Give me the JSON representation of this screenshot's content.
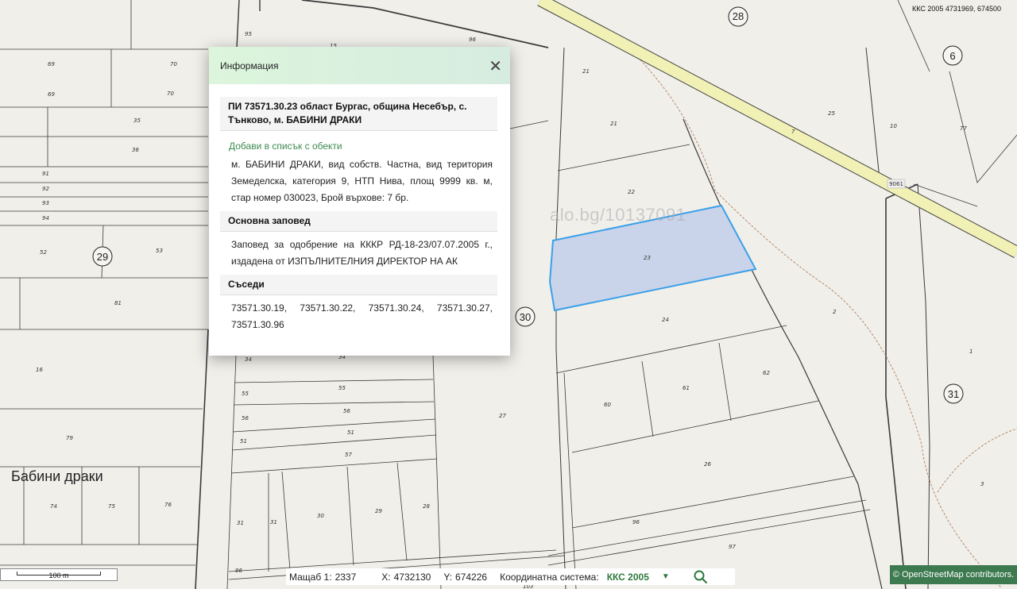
{
  "map": {
    "coord_readout": "ККС 2005 4731969, 674500",
    "watermark": "alo.bg/10137091",
    "area_name": "Бабини драки",
    "circle_labels": [
      "28",
      "6",
      "29",
      "30",
      "31"
    ],
    "road_label": "9061",
    "parcel_labels": [
      "95",
      "96",
      "15",
      "69",
      "70",
      "69",
      "70",
      "35",
      "36",
      "91",
      "92",
      "93",
      "94",
      "52",
      "53",
      "81",
      "16",
      "79",
      "74",
      "75",
      "76",
      "34",
      "34",
      "55",
      "55",
      "56",
      "56",
      "51",
      "51",
      "57",
      "31",
      "31",
      "30",
      "29",
      "28",
      "27",
      "21",
      "21",
      "22",
      "23",
      "24",
      "25",
      "10",
      "7",
      "77",
      "2",
      "1",
      "3",
      "60",
      "61",
      "62",
      "26",
      "97",
      "96",
      "96",
      "103"
    ]
  },
  "popup": {
    "title": "Информация",
    "close_icon": "close-icon",
    "parcel_heading": "ПИ 73571.30.23 област Бургас, община Несебър, с. Тънково, м. БАБИНИ ДРАКИ",
    "add_link": "Добави в списък с обекти",
    "details": "м. БАБИНИ ДРАКИ, вид собств. Частна, вид територия Земеделска, категория 9, НТП Нива, площ 9999 кв. м, стар номер 030023, Брой върхове: 7 бр.",
    "order_heading": "Основна заповед",
    "order_text": "Заповед за одобрение на КККР РД-18-23/07.07.2005 г., издадена от ИЗПЪЛНИТЕЛНИЯ ДИРЕКТОР НА АК",
    "neighbors_heading": "Съседи",
    "neighbors_text": "73571.30.19, 73571.30.22, 73571.30.24, 73571.30.27, 73571.30.96"
  },
  "scale": {
    "label": "100 m"
  },
  "status": {
    "scale_label": "Мащаб 1:",
    "scale_value": "2337",
    "x_label": "X:",
    "x_value": "4732130",
    "y_label": "Y:",
    "y_value": "674226",
    "crs_label": "Координатна система:",
    "crs_value": "ККС 2005",
    "dropdown_icon": "chevron-down-icon",
    "search_icon": "search-icon"
  },
  "attribution": {
    "text": "© OpenStreetMap contributors."
  },
  "colors": {
    "highlight_fill": "#c9d3ea",
    "highlight_stroke": "#3aa0e8",
    "road": "#f1f1b6",
    "link": "#3b8a4f",
    "header": "#dcf5dc"
  }
}
